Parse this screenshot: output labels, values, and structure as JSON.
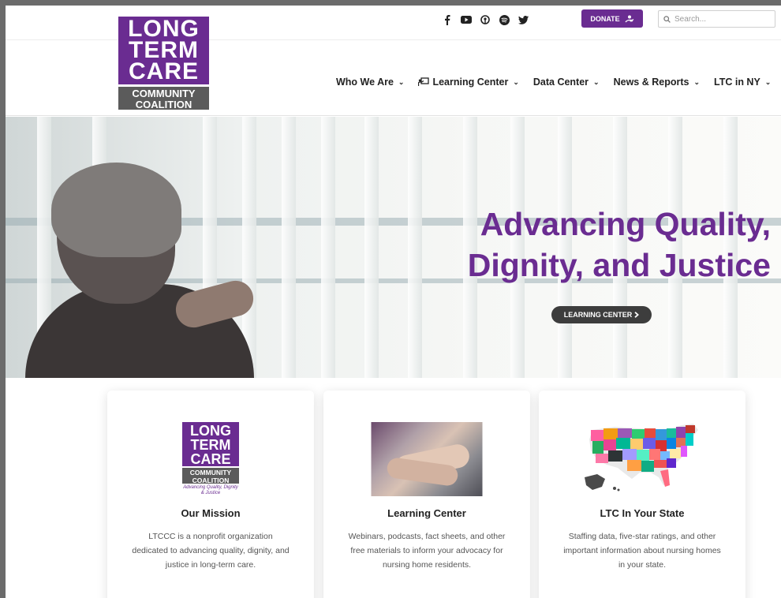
{
  "header": {
    "logo": {
      "line1": "LONG",
      "line2": "TERM",
      "line3": "CARE",
      "sub1": "COMMUNITY",
      "sub2": "COALITION"
    },
    "socials": [
      "facebook-icon",
      "youtube-icon",
      "podcast-icon",
      "spotify-icon",
      "twitter-icon"
    ],
    "donate_label": "DONATE",
    "search_placeholder": "Search...",
    "nav": [
      {
        "label": "Who We Are"
      },
      {
        "label": "Learning Center"
      },
      {
        "label": "Data Center"
      },
      {
        "label": "News & Reports"
      },
      {
        "label": "LTC in NY"
      }
    ]
  },
  "hero": {
    "title_line1": "Advancing Quality,",
    "title_line2": "Dignity, and Justice",
    "button_label": "LEARNING CENTER"
  },
  "cards": [
    {
      "title": "Our Mission",
      "text": "LTCCC is a nonprofit organization dedicated to advancing quality, dignity, and justice in long-term care.",
      "logo_tagline": "Advancing Quality, Dignity & Justice"
    },
    {
      "title": "Learning Center",
      "text": "Webinars, podcasts, fact sheets, and other free materials to inform your advocacy for nursing home residents."
    },
    {
      "title": "LTC In Your State",
      "text": "Staffing data, five-star ratings, and other important information about nursing homes in your state."
    }
  ],
  "colors": {
    "brand_purple": "#6a2c91",
    "dark_button": "#3d3d3d",
    "logo_gray": "#5b5b5b"
  }
}
